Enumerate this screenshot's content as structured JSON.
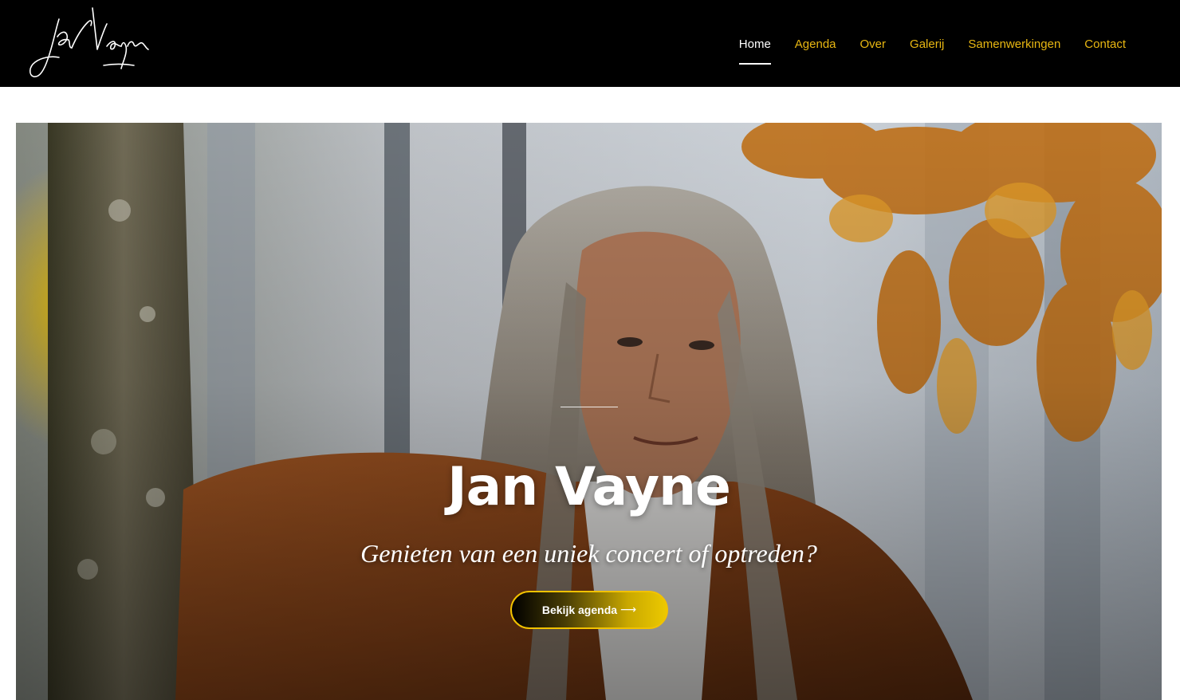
{
  "header": {
    "logo_text": "Jan Vayne",
    "nav": [
      {
        "label": "Home",
        "active": true
      },
      {
        "label": "Agenda",
        "active": false
      },
      {
        "label": "Over",
        "active": false
      },
      {
        "label": "Galerij",
        "active": false
      },
      {
        "label": "Samenwerkingen",
        "active": false
      },
      {
        "label": "Contact",
        "active": false
      }
    ]
  },
  "hero": {
    "title": "Jan Vayne",
    "subtitle": "Genieten van een uniek concert of optreden?",
    "cta_label": "Bekijk agenda",
    "cta_arrow": "⟶"
  },
  "colors": {
    "header_bg": "#000000",
    "nav_text": "#e8b712",
    "nav_active": "#ffffff",
    "cta_border": "#f2c200",
    "cta_gradient_end": "#ecc900"
  },
  "icons": {
    "logo": "signature-logo-icon",
    "cta": "arrow-right-icon"
  }
}
